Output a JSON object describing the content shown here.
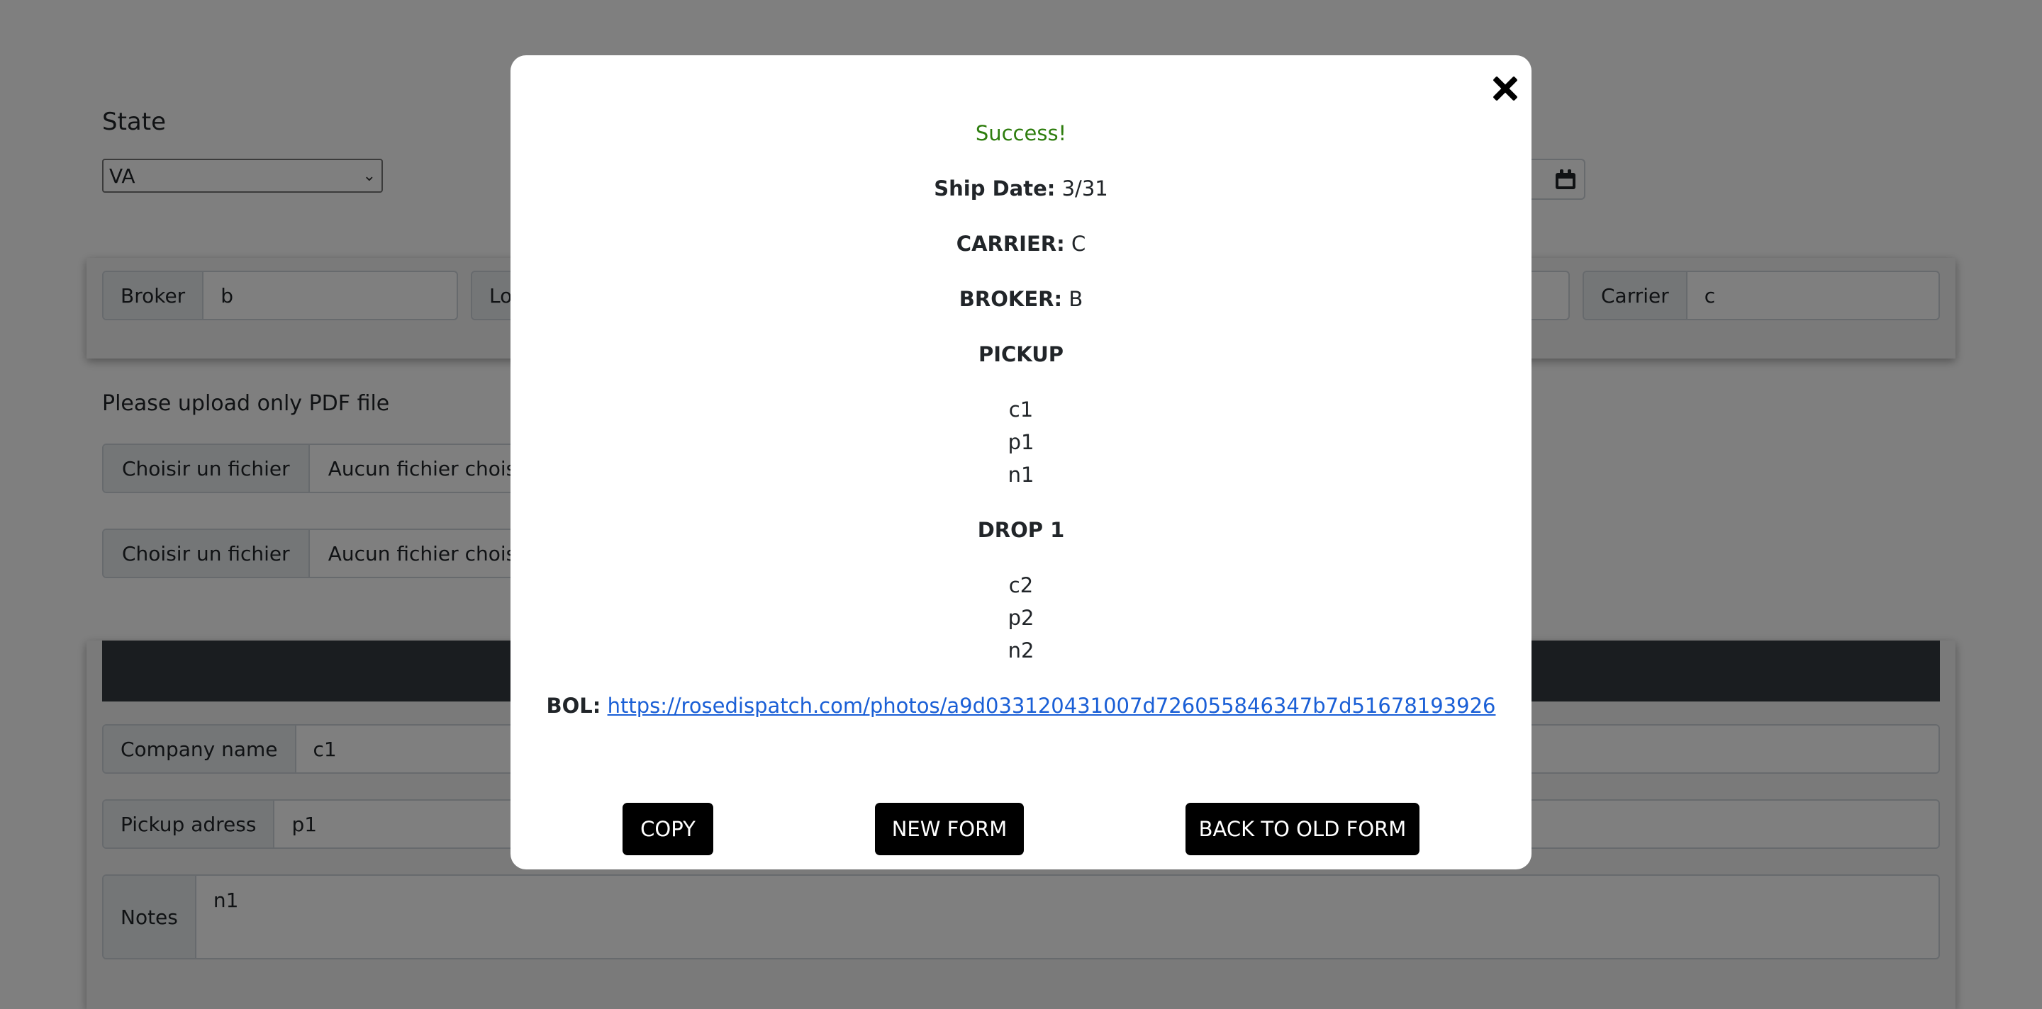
{
  "form": {
    "state_label": "State",
    "state_value": "VA",
    "broker_label": "Broker",
    "broker_value": "b",
    "load_label_partial": "Lo",
    "carrier_label": "Carrier",
    "carrier_value": "c",
    "upload_note": "Please upload only PDF file",
    "file_inputs": [
      {
        "button": "Choisir un fichier",
        "status": "Aucun fichier choisi"
      },
      {
        "button": "Choisir un fichier",
        "status": "Aucun fichier choisi"
      }
    ],
    "pickup": {
      "company_label": "Company name",
      "company_value": "c1",
      "address_label": "Pickup adress",
      "address_value": "p1",
      "notes_label": "Notes",
      "notes_value": "n1"
    }
  },
  "modal": {
    "success": "Success!",
    "ship_date_label": "Ship Date:",
    "ship_date_value": "3/31",
    "carrier_label": "CARRIER:",
    "carrier_value": "C",
    "broker_label": "BROKER:",
    "broker_value": "B",
    "pickup_heading": "PICKUP",
    "pickup_lines": [
      "c1",
      "p1",
      "n1"
    ],
    "drop_heading": "DROP 1",
    "drop_lines": [
      "c2",
      "p2",
      "n2"
    ],
    "bol_label": "BOL:",
    "bol_url": "https://rosedispatch.com/photos/a9d033120431007d726055846347b7d51678193926",
    "buttons": {
      "copy": "COPY",
      "new_form": "NEW FORM",
      "back": "BACK TO OLD FORM"
    }
  },
  "colors": {
    "success": "#2e7d0e",
    "link": "#1a5fd6",
    "overlay": "rgba(0,0,0,0.5)"
  }
}
